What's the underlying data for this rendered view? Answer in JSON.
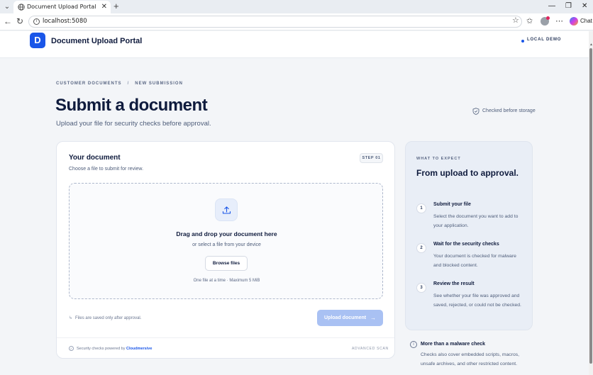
{
  "browser": {
    "tab_title": "Document Upload Portal",
    "url": "localhost:5080",
    "chat_label": "Chat"
  },
  "header": {
    "logo_letter": "D",
    "app_title": "Document Upload Portal",
    "badge": "LOCAL DEMO"
  },
  "breadcrumb": {
    "items": [
      "CUSTOMER DOCUMENTS",
      "NEW SUBMISSION"
    ],
    "separator": "/"
  },
  "page": {
    "title": "Submit a document",
    "subtitle": "Upload your file for security checks before approval.",
    "checked_badge": "Checked before storage"
  },
  "card": {
    "title": "Your document",
    "subtitle": "Choose a file to submit for review.",
    "step_badge": "STEP 01",
    "dropzone": {
      "title": "Drag and drop your document here",
      "subtitle": "or select a file from your device",
      "browse_label": "Browse files",
      "hint": "One file at a time · Maximum 5 MiB"
    },
    "footnote": "Files are saved only after approval.",
    "upload_label": "Upload document",
    "upload_arrow": "→",
    "footer": {
      "powered_prefix": "Security checks powered by",
      "powered_brand": "Cloudmersive",
      "advanced": "ADVANCED SCAN"
    }
  },
  "side": {
    "eyebrow": "WHAT TO EXPECT",
    "title": "From upload to approval.",
    "steps": [
      {
        "num": "1",
        "title": "Submit your file",
        "desc": "Select the document you want to add to your application."
      },
      {
        "num": "2",
        "title": "Wait for the security checks",
        "desc": "Your document is checked for malware and blocked content."
      },
      {
        "num": "3",
        "title": "Review the result",
        "desc": "See whether your file was approved and saved, rejected, or could not be checked."
      }
    ]
  },
  "more": {
    "title": "More than a malware check",
    "desc": "Checks also cover embedded scripts, macros, unsafe archives, and other restricted content."
  },
  "colors": {
    "accent": "#1a56e8",
    "upload_button_disabled": "#a9c1f3",
    "page_bg": "#f3f5f8",
    "side_panel_bg": "#e9eef6"
  }
}
